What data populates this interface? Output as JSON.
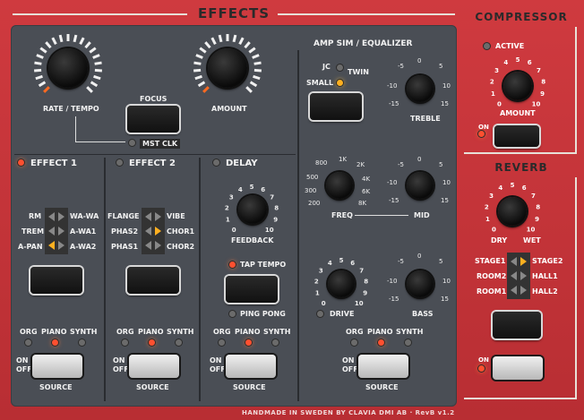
{
  "effects": {
    "title": "EFFECTS",
    "rate_tempo": "RATE / TEMPO",
    "amount": "AMOUNT",
    "focus": "FOCUS",
    "mst_clk": "MST CLK",
    "effect1": {
      "title": "EFFECT 1",
      "left": [
        "RM",
        "TREM",
        "A-PAN"
      ],
      "right": [
        "WA-WA",
        "A-WA1",
        "A-WA2"
      ]
    },
    "effect2": {
      "title": "EFFECT 2",
      "left": [
        "FLANGE",
        "PHAS2",
        "PHAS1"
      ],
      "right": [
        "VIBE",
        "CHOR1",
        "CHOR2"
      ]
    },
    "delay": {
      "title": "DELAY",
      "feedback": "FEEDBACK",
      "tap_tempo": "TAP TEMPO",
      "ping_pong": "PING PONG"
    },
    "source": {
      "org": "ORG",
      "piano": "PIANO",
      "synth": "SYNTH",
      "label": "SOURCE",
      "on": "ON",
      "off": "OFF"
    }
  },
  "amp": {
    "title": "AMP SIM / EQUALIZER",
    "jc": "JC",
    "twin": "TWIN",
    "small": "SMALL",
    "treble": "TREBLE",
    "freq": "FREQ",
    "mid": "MID",
    "drive": "DRIVE",
    "bass": "BASS",
    "freq_ticks": [
      "800",
      "1K",
      "2K",
      "500",
      "4K",
      "300",
      "6K",
      "200",
      "8K"
    ]
  },
  "compressor": {
    "title": "COMPRESSOR",
    "active": "ACTIVE",
    "amount": "AMOUNT",
    "on": "ON"
  },
  "reverb": {
    "title": "REVERB",
    "dry": "DRY",
    "wet": "WET",
    "on": "ON",
    "left": [
      "STAGE1",
      "ROOM2",
      "ROOM1"
    ],
    "right": [
      "STAGE2",
      "HALL1",
      "HALL2"
    ]
  },
  "footer": "HANDMADE IN SWEDEN BY CLAVIA DMI AB · RevB v1.2",
  "ticks10": [
    "0",
    "1",
    "2",
    "3",
    "4",
    "5",
    "6",
    "7",
    "8",
    "9",
    "10"
  ],
  "ticks15": [
    "-15",
    "-10",
    "-5",
    "0",
    "5",
    "10",
    "15"
  ]
}
